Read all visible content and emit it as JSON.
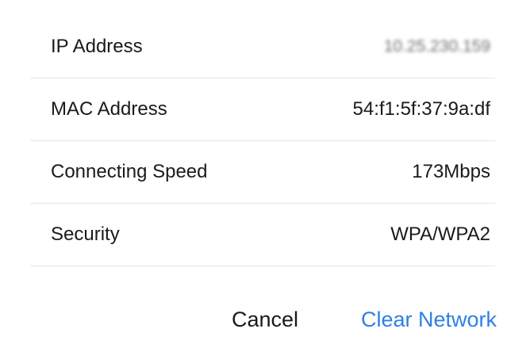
{
  "details": {
    "rows": [
      {
        "label": "IP Address",
        "value": "10.25.230.159"
      },
      {
        "label": "MAC Address",
        "value": "54:f1:5f:37:9a:df"
      },
      {
        "label": "Connecting Speed",
        "value": "173Mbps"
      },
      {
        "label": "Security",
        "value": "WPA/WPA2"
      }
    ]
  },
  "actions": {
    "cancel_label": "Cancel",
    "clear_label": "Clear Network"
  },
  "colors": {
    "text": "#1a1a1a",
    "accent": "#2f7fe6",
    "divider": "#e6e6e6"
  }
}
